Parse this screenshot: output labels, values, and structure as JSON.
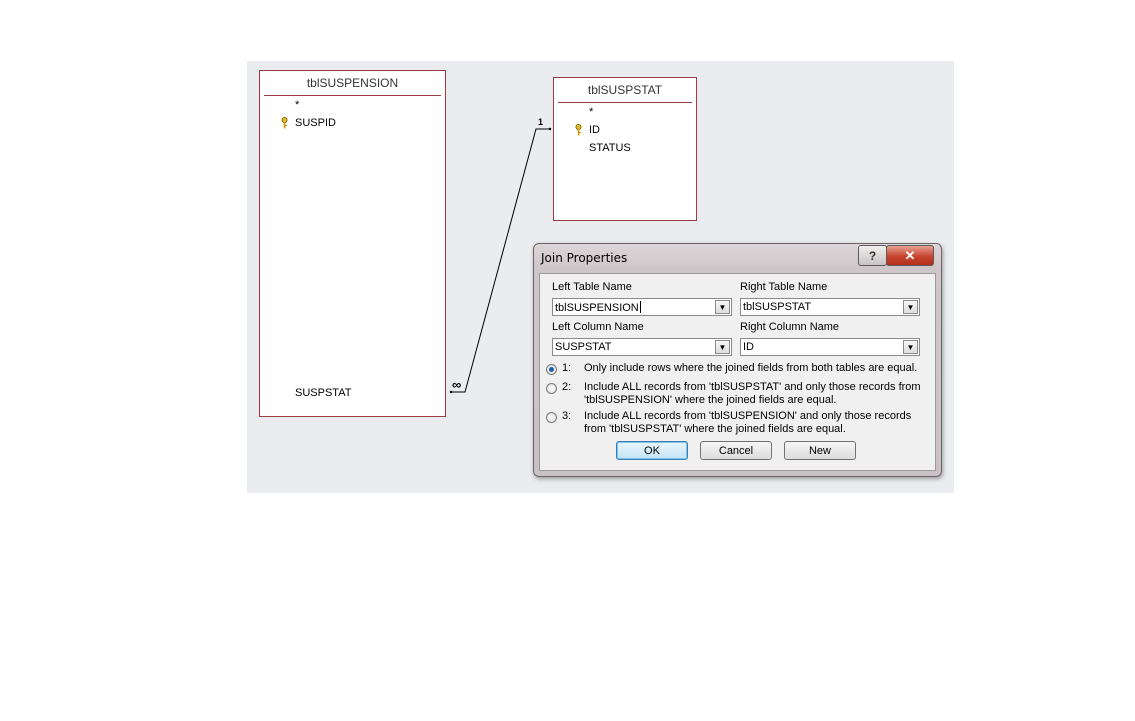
{
  "tables": {
    "left": {
      "title": "tblSUSPENSION",
      "fields": {
        "all": "*",
        "key": "SUSPID",
        "susp": "SUSPSTAT"
      }
    },
    "right": {
      "title": "tblSUSPSTAT",
      "fields": {
        "all": "*",
        "key": "ID",
        "status": "STATUS"
      }
    }
  },
  "relationship": {
    "one_label": "1",
    "many_label": "∞"
  },
  "dialog": {
    "title": "Join Properties",
    "help_label": "?",
    "close_label": "✕",
    "left_table_label": "Left Table Name",
    "left_table_value": "tblSUSPENSION",
    "right_table_label": "Right Table Name",
    "right_table_value": "tblSUSPSTAT",
    "left_column_label": "Left Column Name",
    "left_column_value": "SUSPSTAT",
    "right_column_label": "Right Column Name",
    "right_column_value": "ID",
    "options": [
      {
        "num": "1:",
        "text": "Only include rows where the joined fields from both tables are equal.",
        "selected": true
      },
      {
        "num": "2:",
        "text": "Include ALL records from 'tblSUSPSTAT' and only those records from 'tblSUSPENSION' where the joined fields are equal.",
        "selected": false
      },
      {
        "num": "3:",
        "text": "Include ALL records from 'tblSUSPENSION' and only those records from 'tblSUSPSTAT' where the joined fields are equal.",
        "selected": false
      }
    ],
    "ok_label": "OK",
    "cancel_label": "Cancel",
    "new_label": "New"
  },
  "icons": {
    "key": "key-icon",
    "dropdown": "chevron-down-icon"
  },
  "colors": {
    "table_border": "#9b3b42",
    "canvas": "#eaecef",
    "close_button": "#c7442e"
  }
}
